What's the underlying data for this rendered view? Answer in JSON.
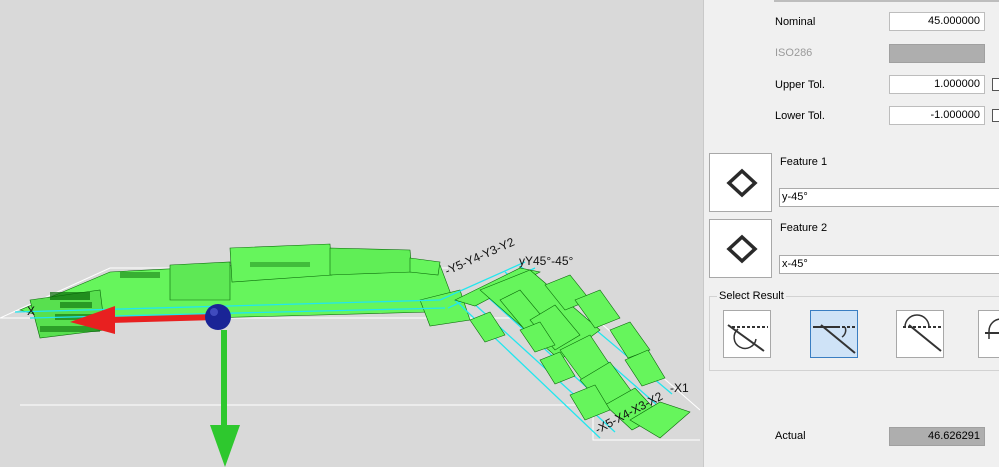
{
  "viewport": {
    "labels": {
      "top_right": "yY45°-45°",
      "mid": "-Y5-Y4-Y3-Y2",
      "x1": "-X1",
      "x_bottom": "-X5-X4-X3-X2",
      "left": "X"
    },
    "colors": {
      "background": "#d9d9d9",
      "part_fill": "#66f55c",
      "part_dark": "#0a6a0a",
      "edge_highlight": "#22e6ee",
      "arrow_x": "#e82020",
      "arrow_z": "#2ec82e",
      "origin": "#1a2496"
    }
  },
  "panel": {
    "nominal": {
      "label": "Nominal",
      "value": "45.000000"
    },
    "iso286": {
      "label": "ISO286",
      "value": ""
    },
    "upper_tol": {
      "label": "Upper Tol.",
      "value": "1.000000"
    },
    "lower_tol": {
      "label": "Lower Tol.",
      "value": "-1.000000"
    },
    "feature1": {
      "title": "Feature 1",
      "value": "y-45°",
      "icon": "diamond-icon"
    },
    "feature2": {
      "title": "Feature 2",
      "value": "x-45°",
      "icon": "diamond-icon"
    },
    "select_result": {
      "label": "Select Result",
      "options": [
        {
          "icon": "angle-result-1-icon",
          "selected": false
        },
        {
          "icon": "angle-result-2-icon",
          "selected": true
        },
        {
          "icon": "angle-result-3-icon",
          "selected": false
        },
        {
          "icon": "angle-result-4-icon",
          "selected": false
        }
      ]
    },
    "actual": {
      "label": "Actual",
      "value": "46.626291"
    }
  }
}
